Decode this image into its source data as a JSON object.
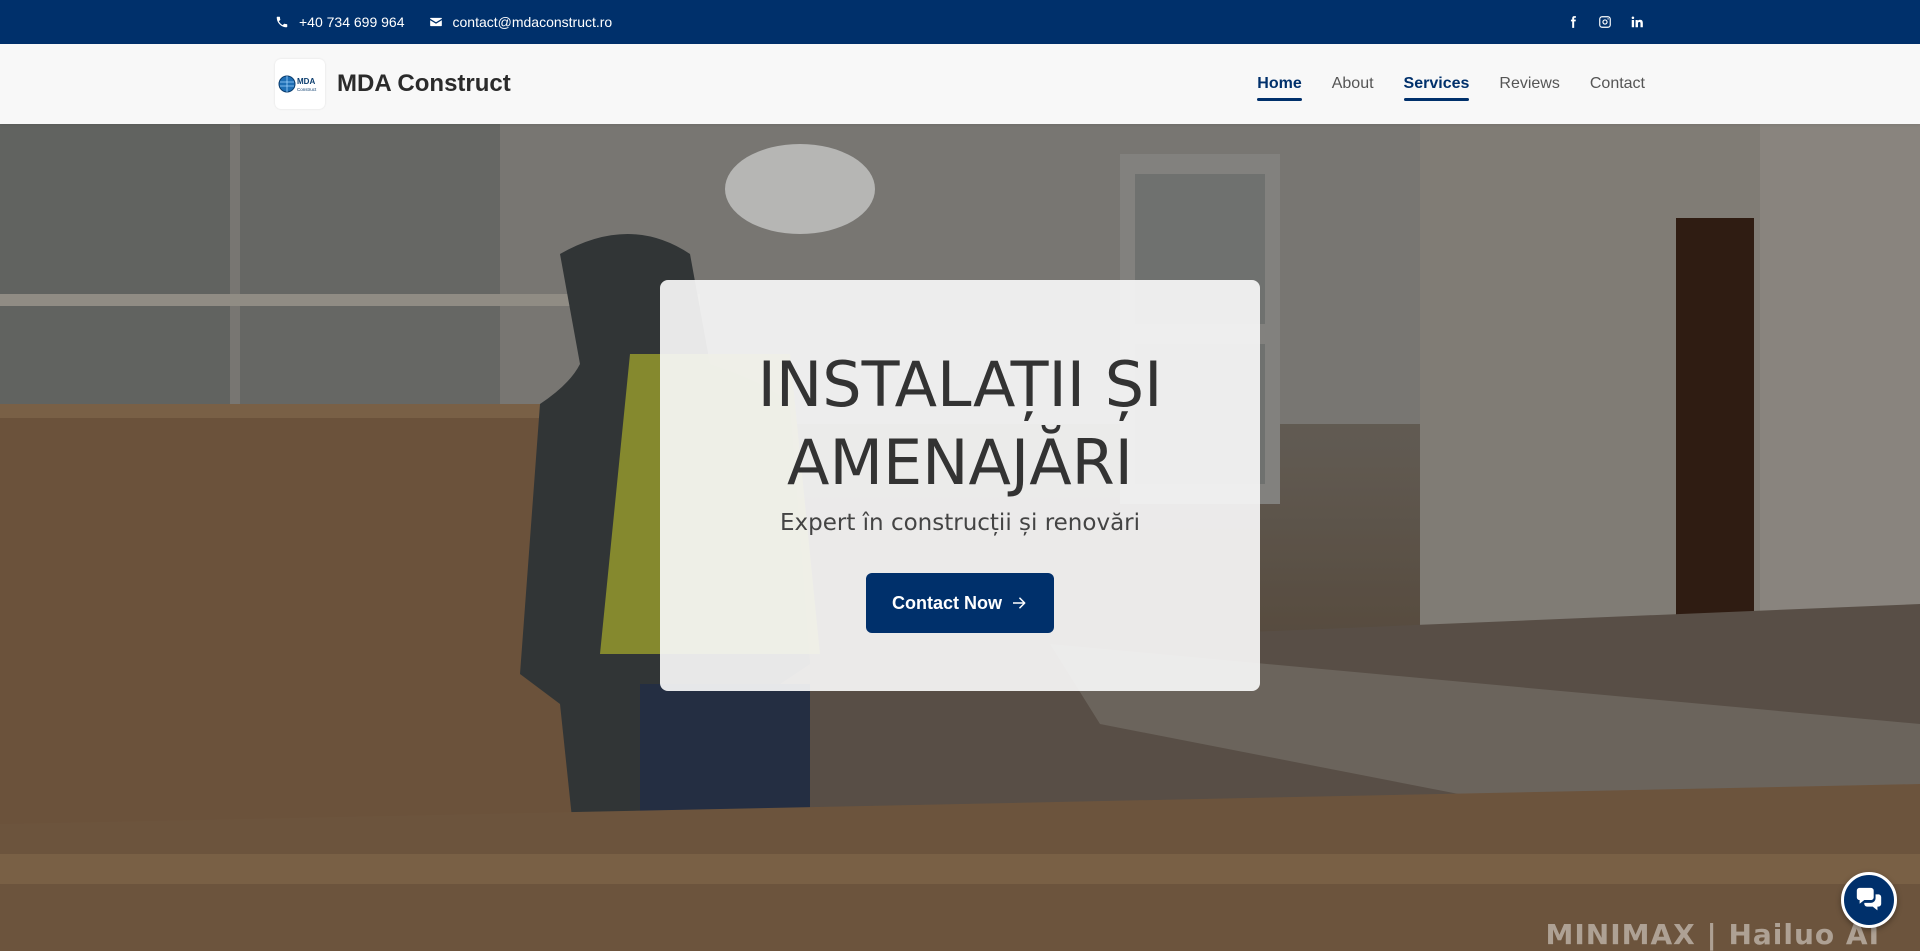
{
  "topbar": {
    "phone": "+40 734 699 964",
    "email": "contact@mdaconstruct.ro",
    "phone_icon": "phone-icon",
    "email_icon": "envelope-icon",
    "social": [
      "facebook-icon",
      "instagram-icon",
      "linkedin-icon"
    ]
  },
  "brand": {
    "name": "MDA Construct",
    "logo_text": "MDA",
    "logo_subtext": "Construct"
  },
  "nav": {
    "items": [
      {
        "label": "Home",
        "active": true
      },
      {
        "label": "About",
        "active": false
      },
      {
        "label": "Services",
        "active": true
      },
      {
        "label": "Reviews",
        "active": false
      },
      {
        "label": "Contact",
        "active": false
      }
    ]
  },
  "hero": {
    "title_line1": "INSTALAȚII ȘI",
    "title_line2": "AMENAJĂRI",
    "subtitle": "Expert în construcții și renovări",
    "cta_label": "Contact Now",
    "cta_icon": "arrow-right-icon"
  },
  "watermark": "MINIMAX | Hailuo AI",
  "chat": {
    "icon": "chat-bubbles-icon"
  },
  "colors": {
    "primary": "#00306b",
    "nav_bg": "#f8f8f8",
    "text_dark": "#333333"
  }
}
